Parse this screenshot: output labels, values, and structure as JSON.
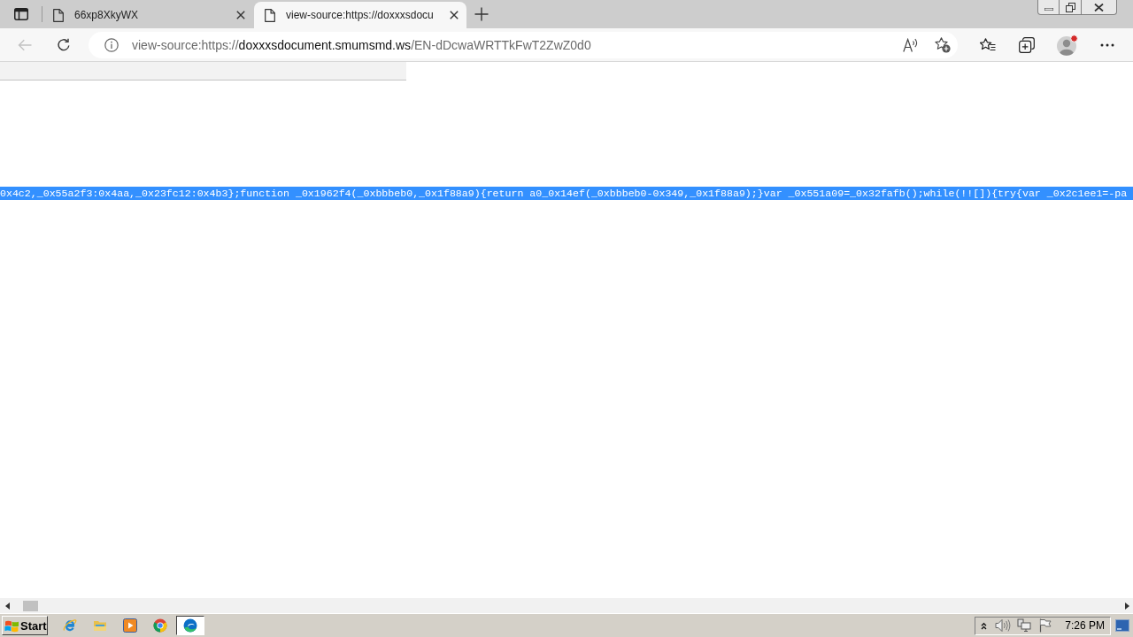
{
  "tabs": [
    {
      "title": "66xp8XkyWX",
      "selected": false
    },
    {
      "title": "view-source:https://doxxxsdocu",
      "selected": true
    }
  ],
  "back_button": {
    "disabled": true
  },
  "address_bar": {
    "scheme": "view-source:https://",
    "host": "doxxxsdocument.smumsmd.ws",
    "path": "/EN-dDcwaWRTTkFwT2ZwZ0d0"
  },
  "profile": {
    "notification": true
  },
  "source_lines": [
    {
      "text": "0x4c2,_0x55a2f3:0x4aa,_0x23fc12:0x4b3};function _0x1962f4(_0xbbbeb0,_0x1f88a9){return a0_0x14ef(_0xbbbeb0-0x349,_0x1f88a9);}var _0x551a09=_0x32fafb();while(!![]){try{var _0x2c1ee1=-pa",
      "selected": true
    }
  ],
  "taskbar": {
    "start_label": "Start",
    "apps": [
      {
        "kind": "globe",
        "selected": false
      },
      {
        "kind": "folder",
        "selected": false
      },
      {
        "kind": "player",
        "selected": false
      },
      {
        "kind": "ring",
        "selected": false
      },
      {
        "kind": "swirl",
        "selected": true
      }
    ],
    "clock": "7:26 PM"
  }
}
